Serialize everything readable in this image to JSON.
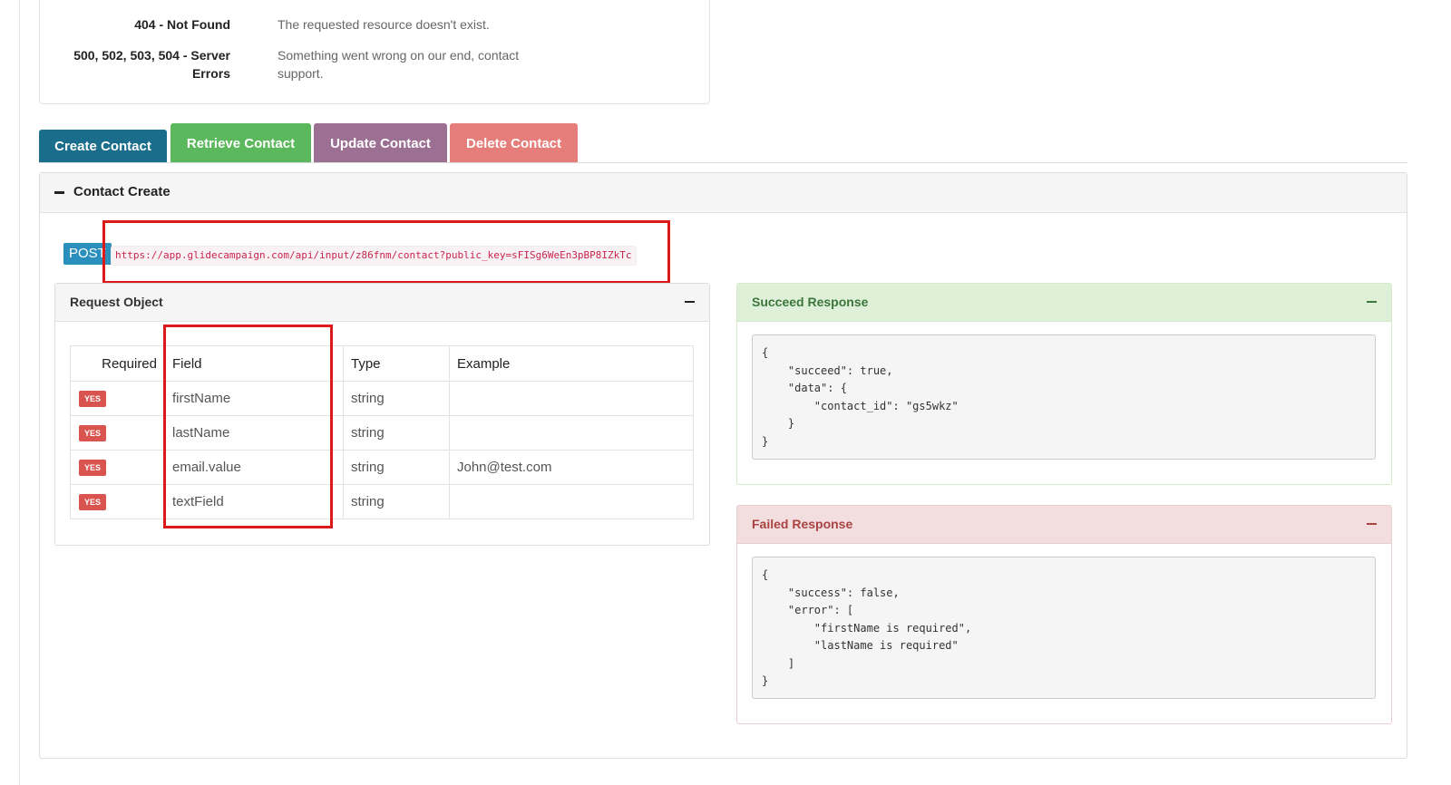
{
  "status_codes": [
    {
      "code": "404 - Not Found",
      "description": "The requested resource doesn't exist."
    },
    {
      "code": "500, 502, 503, 504 - Server Errors",
      "description": "Something went wrong on our end, contact support."
    }
  ],
  "tabs": [
    {
      "label": "Create Contact",
      "color": "#1b6d8c",
      "active": true
    },
    {
      "label": "Retrieve Contact",
      "color": "#5cb85c",
      "active": false
    },
    {
      "label": "Update Contact",
      "color": "#9c7092",
      "active": false
    },
    {
      "label": "Delete Contact",
      "color": "#e57d7a",
      "active": false
    }
  ],
  "panel": {
    "title": "Contact Create",
    "method": "POST",
    "url": "https://app.glidecampaign.com/api/input/z86fnm/contact?public_key=sFISg6WeEn3pBP8IZkTc"
  },
  "request_object": {
    "title": "Request Object",
    "columns": [
      "Required",
      "Field",
      "Type",
      "Example"
    ],
    "rows": [
      {
        "required": "YES",
        "field": "firstName",
        "type": "string",
        "example": ""
      },
      {
        "required": "YES",
        "field": "lastName",
        "type": "string",
        "example": ""
      },
      {
        "required": "YES",
        "field": "email.value",
        "type": "string",
        "example": "John@test.com"
      },
      {
        "required": "YES",
        "field": "textField",
        "type": "string",
        "example": ""
      }
    ]
  },
  "succeed_response": {
    "title": "Succeed Response",
    "code": "{\n    \"succeed\": true,\n    \"data\": {\n        \"contact_id\": \"gs5wkz\"\n    }\n}"
  },
  "failed_response": {
    "title": "Failed Response",
    "code": "{\n    \"success\": false,\n    \"error\": [\n        \"firstName is required\",\n        \"lastName is required\"\n    ]\n}"
  },
  "colors": {
    "success_header_bg": "#dff0d8",
    "success_header_text": "#3c763d",
    "danger_header_bg": "#f2dede",
    "danger_header_text": "#a94442",
    "highlight": "#dd1a1a"
  }
}
